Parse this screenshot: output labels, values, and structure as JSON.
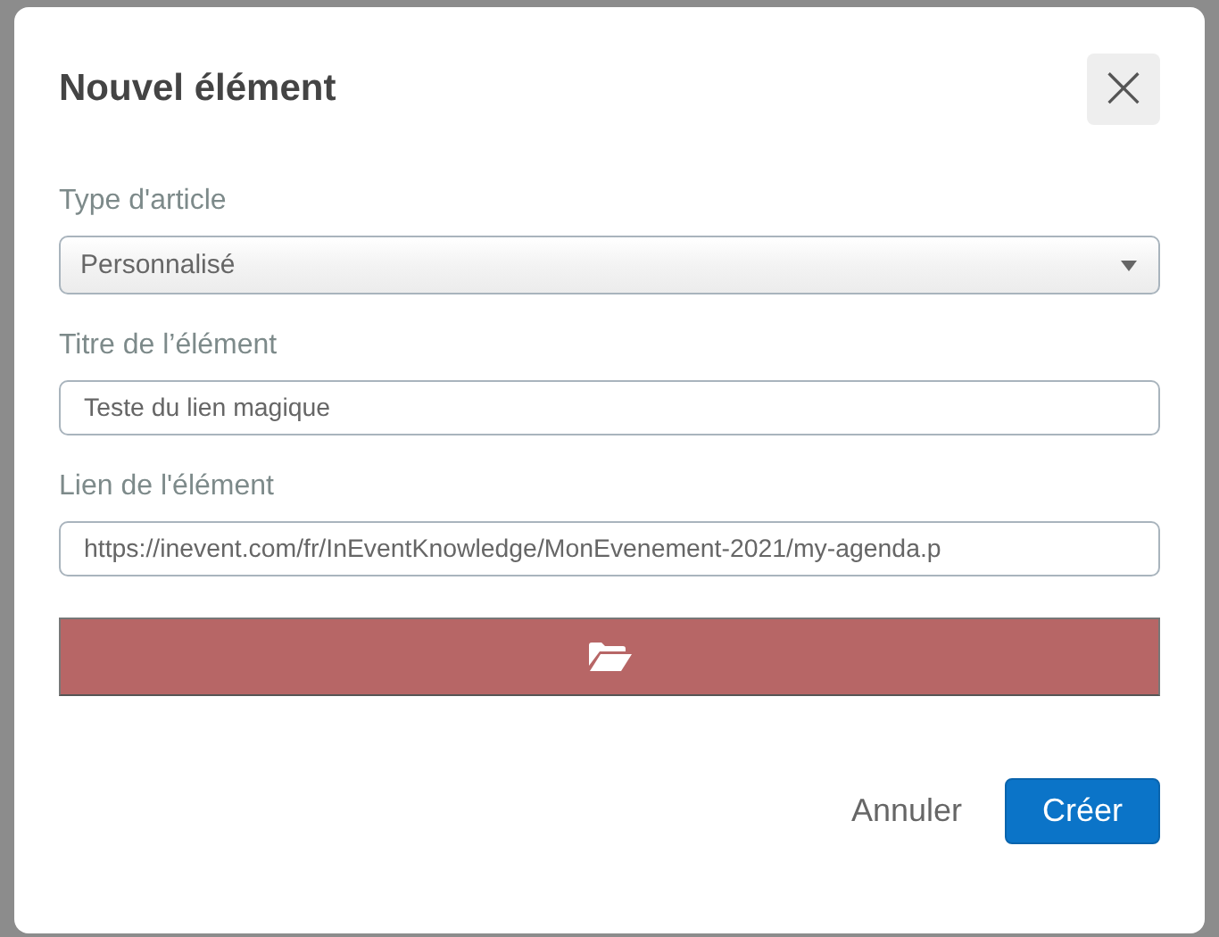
{
  "dialog": {
    "title": "Nouvel élément",
    "close_label": "×"
  },
  "fields": [
    {
      "kind": "select",
      "label": "Type d'article",
      "value": "Personnalisé"
    },
    {
      "kind": "text",
      "label": "Titre de l’élément",
      "value": "Teste du lien magique"
    },
    {
      "kind": "text",
      "label": "Lien de l'élément",
      "value": "https://inevent.com/fr/InEventKnowledge/MonEvenement-2021/my-agenda.p"
    }
  ],
  "buttons": [
    {
      "label": "Annuler",
      "kind": "link"
    },
    {
      "label": "Créer",
      "kind": "primary"
    }
  ]
}
